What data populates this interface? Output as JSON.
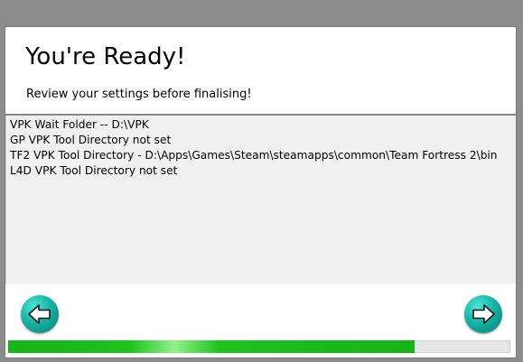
{
  "header": {
    "title": "You're Ready!",
    "subtitle": "Review your settings before finalising!"
  },
  "settings": {
    "lines": [
      "VPK Wait Folder -- D:\\VPK",
      "GP VPK Tool Directory not set",
      "TF2 VPK Tool Directory - D:\\Apps\\Games\\Steam\\steamapps\\common\\Team Fortress 2\\bin",
      "L4D VPK Tool Directory not set"
    ]
  },
  "footer": {
    "back_icon": "arrow-left-icon",
    "next_icon": "arrow-right-icon",
    "progress_fraction": 0.81
  },
  "colors": {
    "button": "#16b3a5",
    "progress": "#1fc11f",
    "content_bg": "#f0f0f0"
  }
}
